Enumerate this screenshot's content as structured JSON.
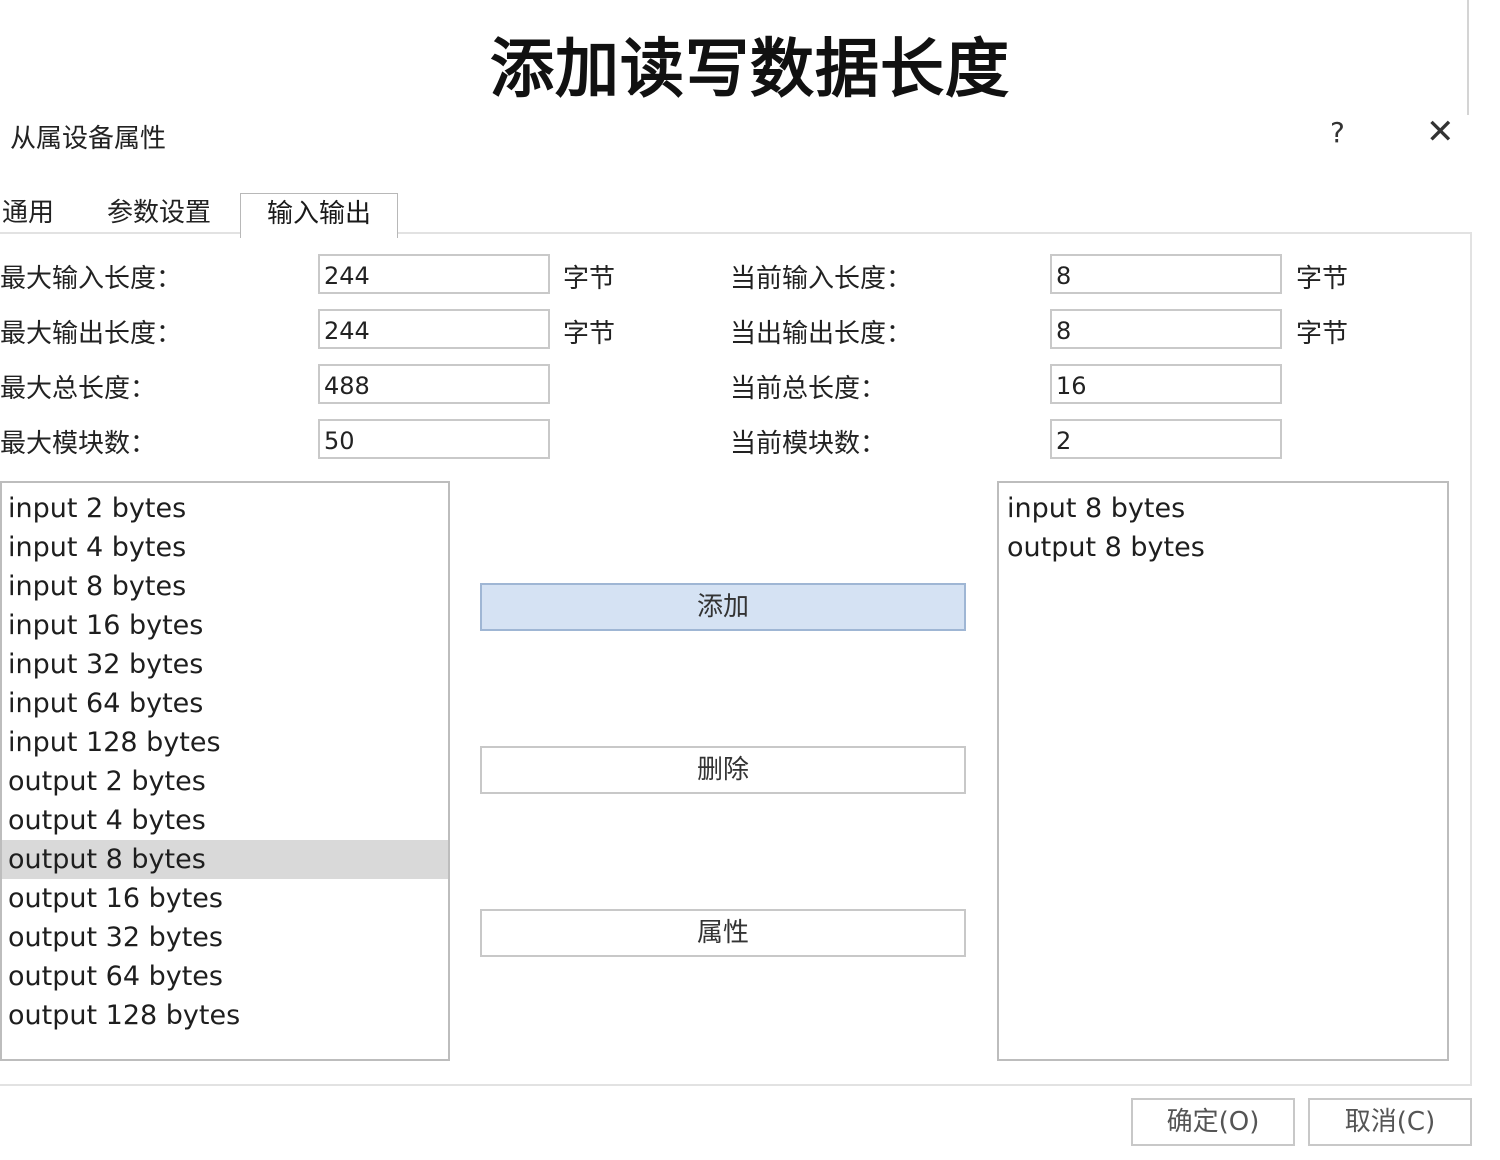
{
  "heading": "添加读写数据长度",
  "dialog": {
    "title": "从属设备属性",
    "help_label": "?",
    "close_label": "✕"
  },
  "tabs": [
    "通用",
    "参数设置",
    "输入输出"
  ],
  "active_tab": "输入输出",
  "fields_left": [
    {
      "label": "最大输入长度：",
      "value": "244",
      "unit": "字节"
    },
    {
      "label": "最大输出长度：",
      "value": "244",
      "unit": "字节"
    },
    {
      "label": "最大总长度：",
      "value": "488",
      "unit": ""
    },
    {
      "label": "最大模块数：",
      "value": "50",
      "unit": ""
    }
  ],
  "fields_right": [
    {
      "label": "当前输入长度：",
      "value": "8",
      "unit": "字节"
    },
    {
      "label": "当出输出长度：",
      "value": "8",
      "unit": "字节"
    },
    {
      "label": "当前总长度：",
      "value": "16",
      "unit": ""
    },
    {
      "label": "当前模块数：",
      "value": "2",
      "unit": ""
    }
  ],
  "available_modules": [
    "input 2 bytes",
    "input 4 bytes",
    "input 8 bytes",
    "input 16 bytes",
    "input 32 bytes",
    "input 64 bytes",
    "input 128 bytes",
    "output 2 bytes",
    "output 4 bytes",
    "output 8 bytes",
    "output 16 bytes",
    "output 32 bytes",
    "output 64 bytes",
    "output 128 bytes"
  ],
  "selected_available": "output 8 bytes",
  "configured_modules": [
    "input 8 bytes",
    "output 8 bytes"
  ],
  "buttons": {
    "add": "添加",
    "delete": "删除",
    "properties": "属性"
  },
  "footer": {
    "ok": "确定(O)",
    "cancel": "取消(C)"
  },
  "colors": {
    "add_button_bg": "#d5e2f3",
    "selected_row_bg": "#d9d9d9"
  }
}
